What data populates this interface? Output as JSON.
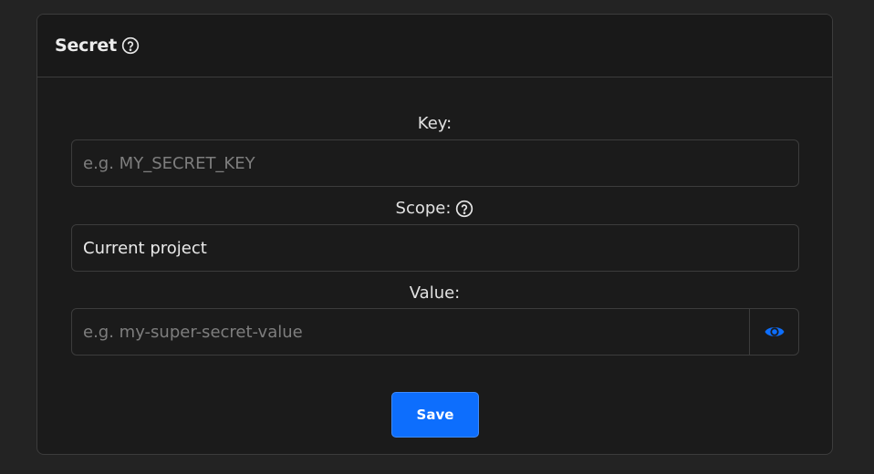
{
  "card": {
    "title": "Secret",
    "title_icon": "help-circle-icon"
  },
  "form": {
    "key": {
      "label": "Key:",
      "placeholder": "e.g. MY_SECRET_KEY",
      "value": ""
    },
    "scope": {
      "label": "Scope:",
      "label_icon": "help-circle-icon",
      "selected": "Current project"
    },
    "value": {
      "label": "Value:",
      "placeholder": "e.g. my-super-secret-value",
      "value": "",
      "toggle_icon": "eye-icon"
    },
    "save_label": "Save"
  },
  "colors": {
    "background": "#232323",
    "card": "#1b1b1b",
    "border": "#3c3c3c",
    "accent": "#0d6efd",
    "placeholder": "#7e7e7e"
  }
}
